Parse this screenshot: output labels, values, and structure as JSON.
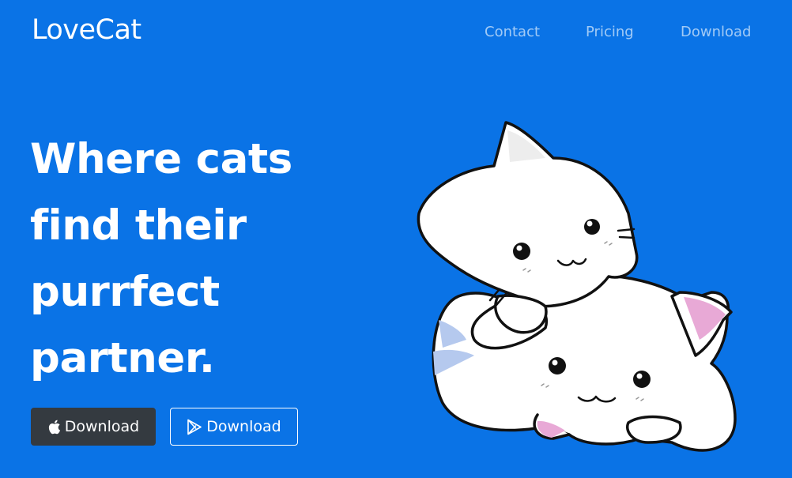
{
  "header": {
    "brand": "LoveCat",
    "nav": [
      {
        "label": "Contact"
      },
      {
        "label": "Pricing"
      },
      {
        "label": "Download"
      }
    ]
  },
  "hero": {
    "headline_lines": [
      "Where cats",
      "find their",
      "purrfect",
      "partner."
    ],
    "buttons": [
      {
        "label": "Download",
        "icon": "apple-icon"
      },
      {
        "label": "Download",
        "icon": "google-play-icon"
      }
    ],
    "illustration": "cat-illustration"
  },
  "colors": {
    "background": "#0a73e6",
    "dark_button": "#343a40",
    "text": "#ffffff",
    "cat_pink": "#e8a9d6",
    "cat_stripe": "#b5c9ee"
  }
}
